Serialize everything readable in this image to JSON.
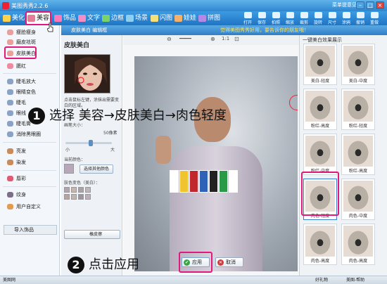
{
  "titlebar": {
    "title": "美图秀秀2.2.6",
    "menu": [
      "菜单",
      "提意见"
    ],
    "minimize": "–",
    "maximize": "□",
    "close": "×"
  },
  "toolbar": {
    "tabs": [
      "美化",
      "美容",
      "饰品",
      "文字",
      "边框",
      "场景",
      "闪图",
      "娃娃",
      "拼图"
    ],
    "tools": [
      "打开",
      "保存",
      "拍照",
      "缩放",
      "裁剪",
      "旋转",
      "尺寸",
      "涂鸦",
      "撤销",
      "重做"
    ]
  },
  "sidebar": {
    "items": [
      "瘦脸瘦身",
      "磨皮祛斑",
      "皮肤美白",
      "腮红",
      "睫毛放大",
      "眼睛变色",
      "睫毛",
      "眼线",
      "睫毛膏",
      "消除黑眼圈",
      "亮发",
      "染发",
      "唇彩",
      "纹身",
      "用户自定义"
    ],
    "import_label": "导入饰品"
  },
  "editor": {
    "header": "皮肤美白 编辑框",
    "panel_title": "皮肤美白",
    "instructions": "点击鼠标左键，涂抹出需要变白的区域。",
    "brush_size_label": "画笔大小：",
    "brush_value": "50像素",
    "slider_min": "小",
    "slider_max": "大",
    "slider_level": 0.55,
    "current_color_label": "当前颜色：",
    "choose_color_btn": "选择其他颜色",
    "skin_color_label": "肤色变色（美白）：",
    "eraser_btn": "橡皮擦",
    "zoom_label": "1:1",
    "apply_btn": "应用",
    "cancel_btn": "取消",
    "colors": {
      "current": "#b7a7b8",
      "swatches": [
        "#b3a4b2",
        "#c9b6a8",
        "#a8a2ab",
        "#c0b5b9",
        "#b8a39d",
        "#c4b4ae",
        "#9d949f",
        "#bdb0ba"
      ]
    }
  },
  "right_panel": {
    "banner": "觉得美图秀秀好用，要告诉你的朋友哦！",
    "title": "一键美白效果展示",
    "presets": [
      "美白-轻度",
      "美白-中度",
      "粉红-高度",
      "粉红-轻度",
      "粉红-中度",
      "粉红-高度",
      "肉色-轻度",
      "肉色-中度",
      "肉色-高度",
      "肉色-高度"
    ]
  },
  "status": {
    "left": "美图网",
    "right_a": "好礼物",
    "right_b": "美图-帮助"
  },
  "tutorial": {
    "step1_num": "1",
    "step1_text": "选择 美容→皮肤美白→肉色轻度",
    "step2_num": "2",
    "step2_text": "点击应用"
  }
}
